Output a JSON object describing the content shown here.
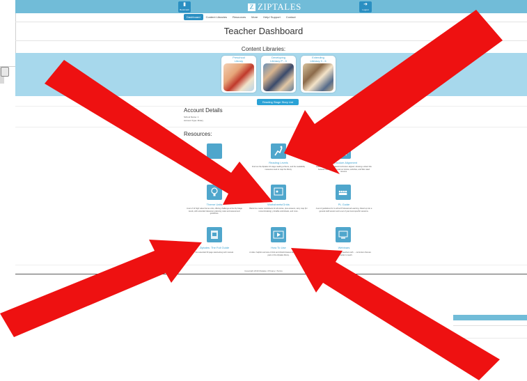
{
  "header": {
    "logo_text": "ZIPTALES",
    "left_button": "Bookmark",
    "right_button": "Logout"
  },
  "nav": [
    "Dashboard",
    "Content Libraries",
    "Resources",
    "More",
    "Help/ Support",
    "Contact"
  ],
  "page_title": "Teacher Dashboard",
  "libraries": {
    "heading": "Content Libraries:",
    "cards": [
      {
        "title_l1": "Preschool",
        "title_l2": "Library"
      },
      {
        "title_l1": "Developing",
        "title_l2": "Literacy P - 3"
      },
      {
        "title_l1": "Extending",
        "title_l2": "Literacy 3 - 6"
      }
    ]
  },
  "reading_stage_button": "Reading Stage Story List",
  "account": {
    "heading": "Account Details",
    "school_name": "School Name: 1",
    "account_type": "Account Type: library"
  },
  "resources": {
    "heading": "Resources:",
    "items": [
      {
        "title": "",
        "desc": "…designed to … Ziptales and the …"
      },
      {
        "title": "Reading Levels",
        "desc": "Find out the Ziptales 10 stage reading scheme, and the readability measures used to map the library."
      },
      {
        "title": "Curriculum Alignment",
        "desc": "Australian and New Zealand Curriculum aligned, showing a direct link between the curriculum and our stories, activities, and SEL rated lessons."
      },
      {
        "title": "Theme Units",
        "desc": "A set of 12 high value theme units, offering challenge at the Zip Stage levels, with extended classroom planning notes and assessment guidelines."
      },
      {
        "title": "Worksheets/Grids",
        "desc": "Blank line master worksheets for all stories, plus answers, story map (for recount/making), printable worksheets, and more."
      },
      {
        "title": "PL Guide",
        "desc": "A set of guidelines for in-school Professional Learning, linked up into a general staff session and a set of year level-specific sessions."
      },
      {
        "title": "Ziptales: The Full Guide",
        "desc": "Our essential 30 page stand-along tech manual."
      },
      {
        "title": "How To Use",
        "desc": "A video: helpful overview of click and inbuild classes dealing with specific parts of the Ziptales library."
      },
      {
        "title": "Webinars",
        "desc": "…webinars aimed at supporting teachers with … curriculum that are often harder to teach."
      }
    ]
  },
  "footer": "Copyright 2019 Ziptales | Privacy | Terms",
  "colors": {
    "header_blue": "#71bcd8",
    "band_blue": "#a7d8ec",
    "accent": "#2a8fc2",
    "arrow_red": "#ee1111"
  }
}
